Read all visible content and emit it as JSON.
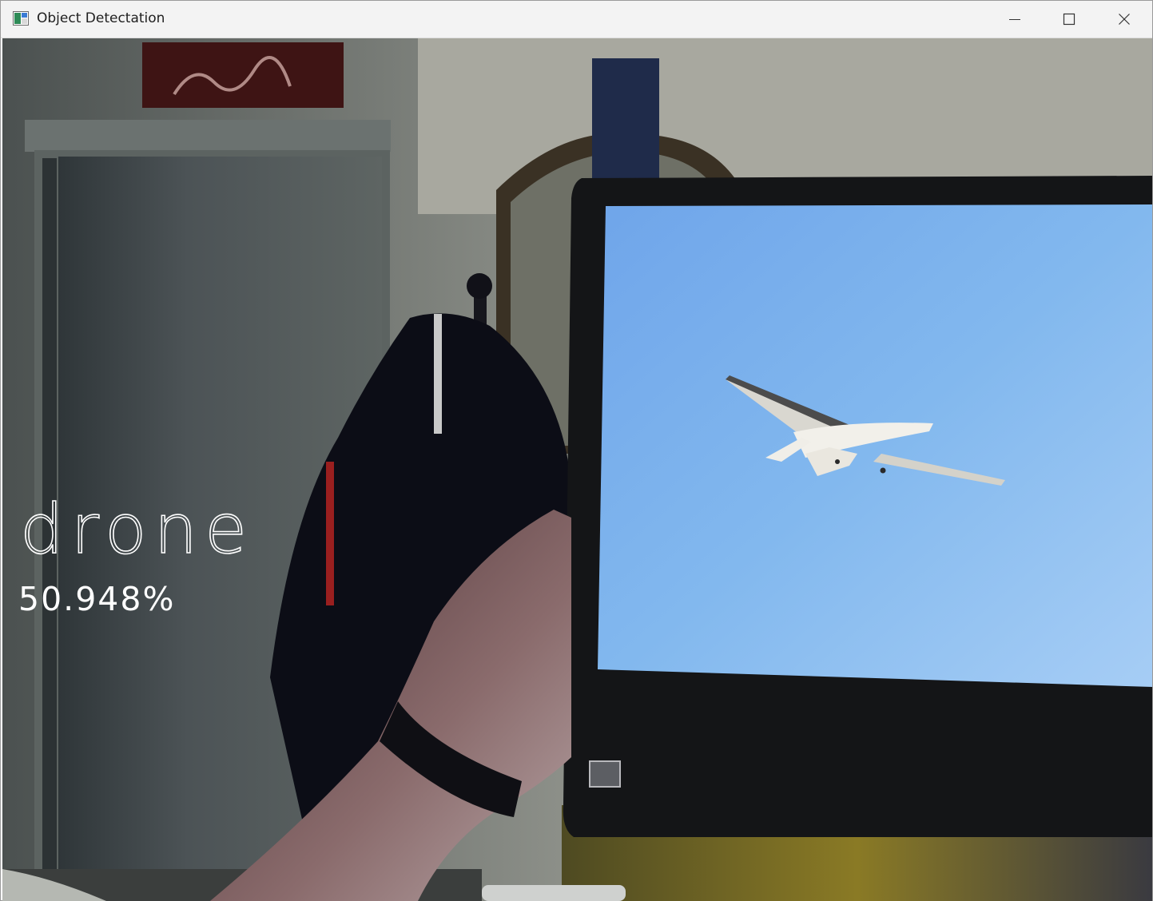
{
  "window": {
    "title": "Object Detectation",
    "icons": {
      "app": "opencv-window-icon",
      "minimize": "minimize-icon",
      "maximize": "maximize-icon",
      "close": "close-icon"
    }
  },
  "detection": {
    "class_label": "drone",
    "confidence_text": "50.948%"
  },
  "colors": {
    "titlebar_bg": "#f3f3f3",
    "overlay_text": "#ffffff",
    "sky_on_screen": "#7eb4ec"
  }
}
